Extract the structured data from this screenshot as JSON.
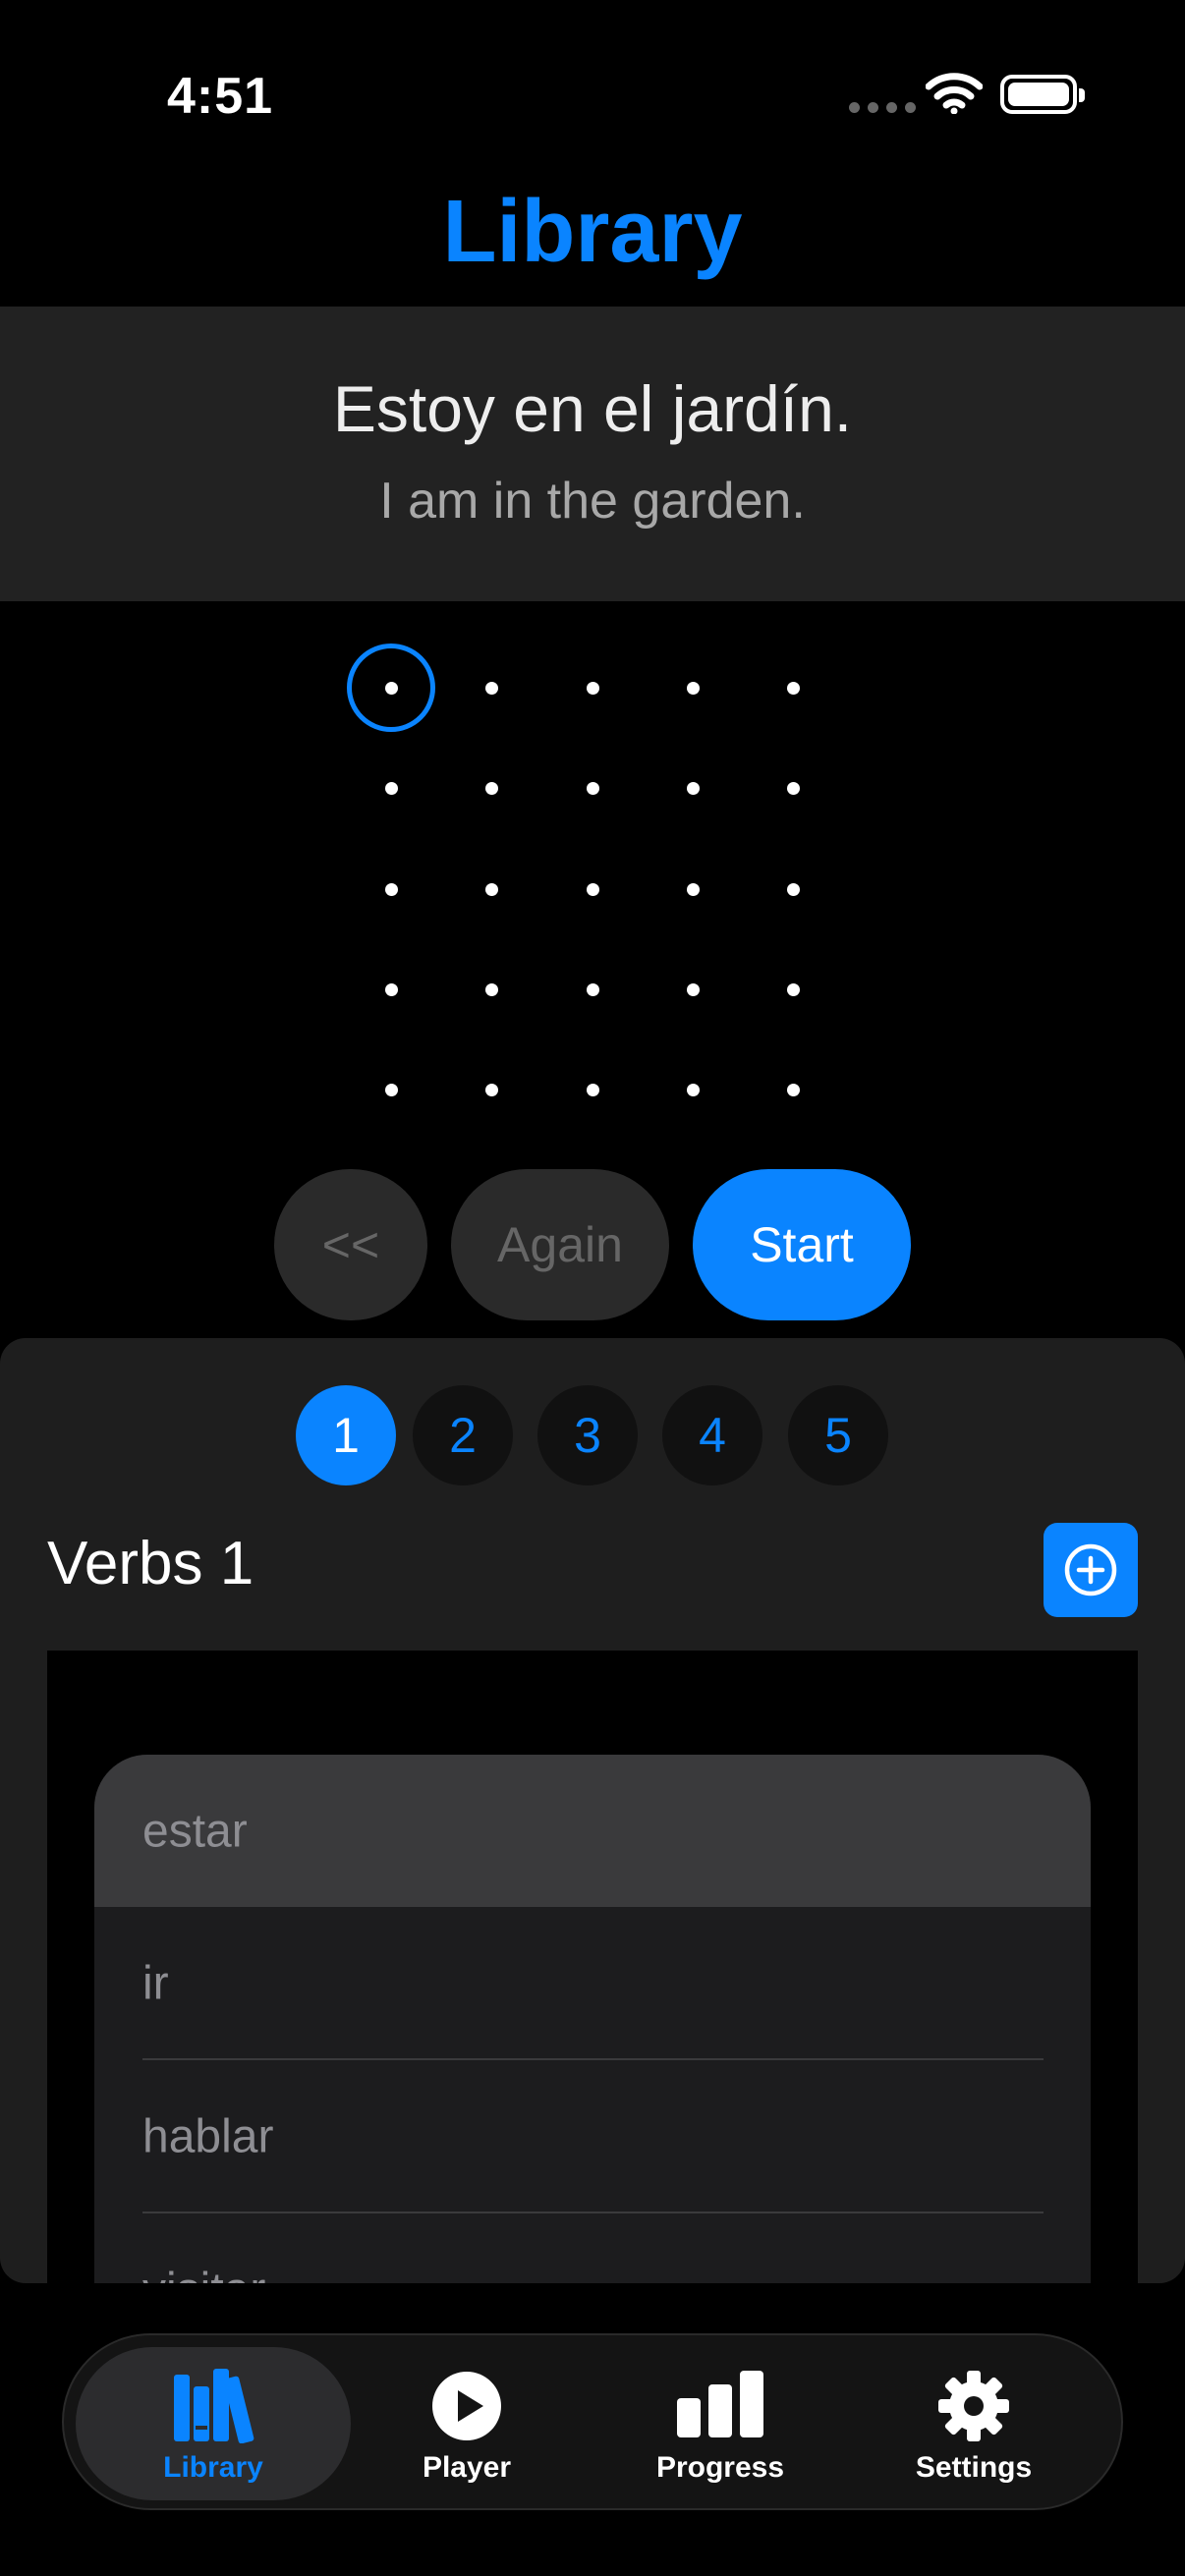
{
  "status": {
    "time": "4:51"
  },
  "header": {
    "title": "Library"
  },
  "sentence": {
    "spanish": "Estoy en el jardín.",
    "english": "I am in the garden."
  },
  "controls": {
    "back_label": "<<",
    "again_label": "Again",
    "start_label": "Start"
  },
  "pages": [
    "1",
    "2",
    "3",
    "4",
    "5"
  ],
  "selected_page": "1",
  "list": {
    "title": "Verbs 1",
    "items": [
      "estar",
      "ir",
      "hablar",
      "visitar"
    ],
    "selected_item": "estar"
  },
  "tabs": [
    {
      "label": "Library",
      "icon": "books-icon"
    },
    {
      "label": "Player",
      "icon": "play-icon"
    },
    {
      "label": "Progress",
      "icon": "chart-icon"
    },
    {
      "label": "Settings",
      "icon": "gear-icon"
    }
  ],
  "active_tab": "Library",
  "colors": {
    "accent": "#0a84ff",
    "background": "#000000",
    "card": "#222222"
  }
}
